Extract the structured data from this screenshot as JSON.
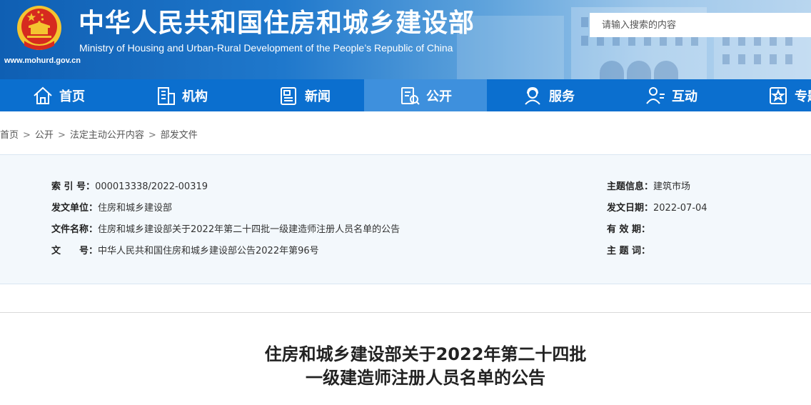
{
  "header": {
    "title_cn": "中华人民共和国住房和城乡建设部",
    "title_en": "Ministry of Housing and Urban-Rural Development of the People’s Republic of China",
    "site_url": "www.mohurd.gov.cn",
    "emblem_icon": "national-emblem-icon",
    "colors": {
      "banner_dark": "#0f5fb3",
      "banner_light": "#b9d6ef",
      "emblem_red": "#d62a1f",
      "emblem_gold": "#f4c430"
    }
  },
  "search": {
    "placeholder": "请输入搜索的内容"
  },
  "nav": {
    "bg_color": "#0b6fcf",
    "active_color": "#3e90dd",
    "items": [
      {
        "label": "首页",
        "icon": "home-icon"
      },
      {
        "label": "机构",
        "icon": "building-icon"
      },
      {
        "label": "新闻",
        "icon": "news-icon"
      },
      {
        "label": "公开",
        "icon": "document-icon",
        "active": true
      },
      {
        "label": "服务",
        "icon": "service-icon"
      },
      {
        "label": "互动",
        "icon": "interaction-icon"
      },
      {
        "label": "专题",
        "icon": "topic-icon"
      }
    ]
  },
  "breadcrumb": [
    "首页",
    "公开",
    "法定主动公开内容",
    "部发文件"
  ],
  "info": {
    "index_label": "索 引 号：",
    "index_value": "000013338/2022-00319",
    "issuer_label": "发文单位：",
    "issuer_value": "住房和城乡建设部",
    "filename_label": "文件名称：",
    "filename_value": "住房和城乡建设部关于2022年第二十四批一级建造师注册人员名单的公告",
    "docnum_label": "文　　号：",
    "docnum_value": "中华人民共和国住房和城乡建设部公告2022年第96号",
    "topic_label": "主题信息：",
    "topic_value": "建筑市场",
    "date_label": "发文日期：",
    "date_value": "2022-07-04",
    "validity_label": "有 效 期：",
    "validity_value": "",
    "keywords_label": "主 题 词：",
    "keywords_value": ""
  },
  "document": {
    "title_line1": "住房和城乡建设部关于2022年第二十四批",
    "title_line2": "一级建造师注册人员名单的公告"
  }
}
